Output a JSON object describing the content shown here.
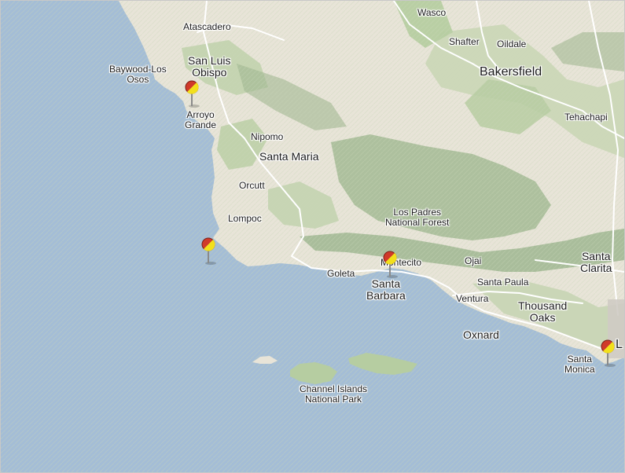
{
  "map": {
    "cities": {
      "wasco": "Wasco",
      "shafter": "Shafter",
      "oildale": "Oildale",
      "bakersfield": "Bakersfield",
      "atascadero": "Atascadero",
      "baywood": "Baywood-Los\nOsos",
      "sanluis": "San Luis\nObispo",
      "arroyo": "Arroyo\nGrande",
      "tehachapi": "Tehachapi",
      "nipomo": "Nipomo",
      "santamaria": "Santa Maria",
      "orcutt": "Orcutt",
      "lompoc": "Lompoc",
      "lospadres": "Los Padres\nNational Forest",
      "montecito": "Montecito",
      "goleta": "Goleta",
      "santabarbara": "Santa\nBarbara",
      "ojai": "Ojai",
      "santapaula": "Santa Paula",
      "santaclarita": "Santa\nClarita",
      "ventura": "Ventura",
      "thousandoaks": "Thousand\nOaks",
      "oxnard": "Oxnard",
      "santamonica": "Santa\nMonica",
      "channelislands": "Channel Islands\nNational Park",
      "la_partial": "L"
    },
    "markers": [
      "map-pin",
      "map-pin",
      "map-pin",
      "map-pin"
    ],
    "colors": {
      "ocean": "#a4bdd6",
      "land": "#e8e4d8",
      "green": "#b6cda1",
      "mountain": "#9eb690",
      "road": "#ffffff",
      "pin_red": "#d03a2a",
      "pin_yellow": "#f2e01c"
    }
  }
}
